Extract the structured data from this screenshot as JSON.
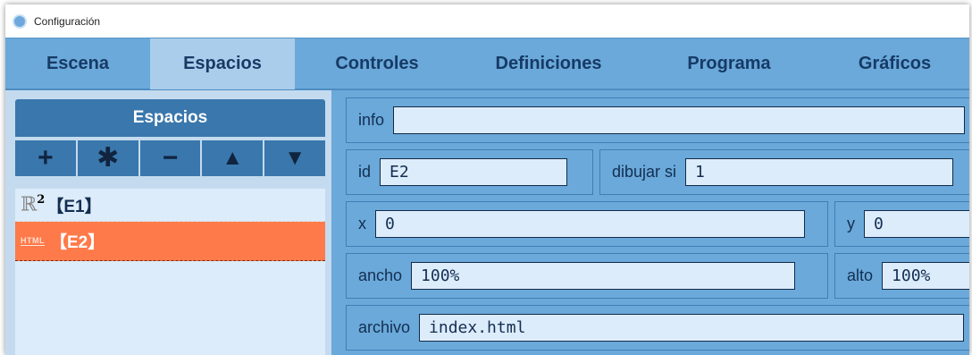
{
  "window": {
    "title": "Configuración"
  },
  "tabs": [
    {
      "label": "Escena"
    },
    {
      "label": "Espacios",
      "active": true
    },
    {
      "label": "Controles"
    },
    {
      "label": "Definiciones"
    },
    {
      "label": "Programa"
    },
    {
      "label": "Gráficos"
    }
  ],
  "left": {
    "header": "Espacios",
    "buttons": {
      "add": "+",
      "clone": "✱",
      "remove": "−",
      "up": "▲",
      "down": "▼"
    },
    "items": [
      {
        "icon": "ℝ",
        "icon_sup": "2",
        "label": "【E1】"
      },
      {
        "icon": "HTML",
        "label": "【E2】",
        "selected": true
      }
    ]
  },
  "fields": {
    "info": {
      "label": "info",
      "value": ""
    },
    "id": {
      "label": "id",
      "value": "E2"
    },
    "drawif": {
      "label": "dibujar si",
      "value": "1"
    },
    "x": {
      "label": "x",
      "value": "0"
    },
    "y": {
      "label": "y",
      "value": "0"
    },
    "width": {
      "label": "ancho",
      "value": "100%"
    },
    "height": {
      "label": "alto",
      "value": "100%"
    },
    "file": {
      "label": "archivo",
      "value": "index.html"
    }
  },
  "colors": {
    "tab_bg": "#6aa9da",
    "tab_active": "#a9cdea",
    "header_bg": "#3a77ac",
    "selected_item": "#ff7a4a",
    "input_bg": "#dcecfa"
  }
}
